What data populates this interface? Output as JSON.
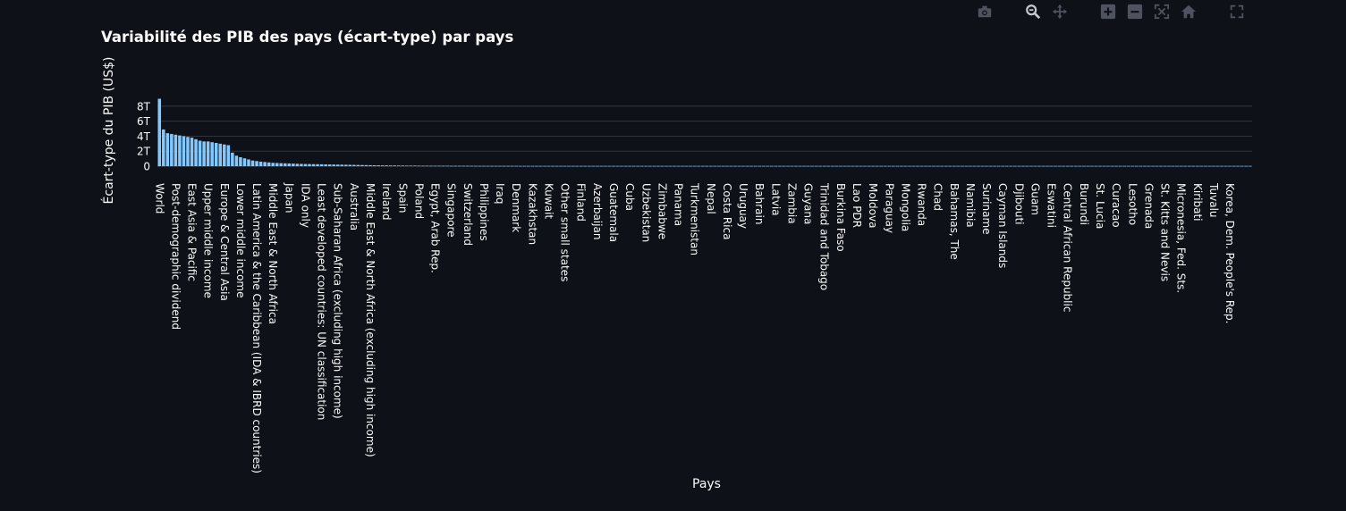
{
  "chart_data": {
    "type": "bar",
    "title": "Variabilité des PIB des pays (écart-type) par pays",
    "xlabel": "Pays",
    "ylabel": "Écart-type du PIB (US$)",
    "ylim": [
      0,
      9.3
    ],
    "yticks": [
      {
        "value": 0,
        "label": "0"
      },
      {
        "value": 2,
        "label": "2T"
      },
      {
        "value": 4,
        "label": "4T"
      },
      {
        "value": 6,
        "label": "6T"
      },
      {
        "value": 8,
        "label": "8T"
      }
    ],
    "bar_color": "#83c9ff",
    "grid": true,
    "categories_labeled": [
      "World",
      "Post-demographic dividend",
      "East Asia & Pacific",
      "Upper middle income",
      "Europe & Central Asia",
      "Lower middle income",
      "Latin America & the Caribbean (IDA & IBRD countries)",
      "Middle East & North Africa",
      "Japan",
      "IDA only",
      "Least developed countries: UN classification",
      "Sub-Saharan Africa (excluding high income)",
      "Australia",
      "Middle East & North Africa (excluding high income)",
      "Ireland",
      "Spain",
      "Poland",
      "Egypt, Arab Rep.",
      "Singapore",
      "Switzerland",
      "Philippines",
      "Iraq",
      "Denmark",
      "Kazakhstan",
      "Kuwait",
      "Other small states",
      "Finland",
      "Azerbaijan",
      "Guatemala",
      "Cuba",
      "Uzbekistan",
      "Zimbabwe",
      "Panama",
      "Turkmenistan",
      "Nepal",
      "Costa Rica",
      "Uruguay",
      "Bahrain",
      "Latvia",
      "Zambia",
      "Guyana",
      "Trinidad and Tobago",
      "Burkina Faso",
      "Lao PDR",
      "Moldova",
      "Paraguay",
      "Mongolia",
      "Rwanda",
      "Chad",
      "Bahamas, The",
      "Namibia",
      "Suriname",
      "Cayman Islands",
      "Djibouti",
      "Guam",
      "Eswatini",
      "Central African Republic",
      "Burundi",
      "St. Lucia",
      "Curacao",
      "Lesotho",
      "Grenada",
      "St. Kitts and Nevis",
      "Micronesia, Fed. Sts.",
      "Kiribati",
      "Tuvalu",
      "Korea, Dem. People's Rep."
    ],
    "values": [
      9.0,
      4.9,
      4.4,
      4.3,
      4.2,
      4.1,
      4.0,
      3.9,
      3.8,
      3.6,
      3.4,
      3.3,
      3.3,
      3.2,
      3.1,
      3.0,
      2.9,
      2.8,
      1.8,
      1.4,
      1.2,
      1.05,
      0.9,
      0.75,
      0.68,
      0.6,
      0.55,
      0.5,
      0.45,
      0.42,
      0.4,
      0.38,
      0.36,
      0.34,
      0.32,
      0.3,
      0.29,
      0.28,
      0.27,
      0.26,
      0.25,
      0.24,
      0.23,
      0.22,
      0.21,
      0.2,
      0.19,
      0.18,
      0.17,
      0.16,
      0.15,
      0.14,
      0.13,
      0.12,
      0.11,
      0.1,
      0.1,
      0.09,
      0.09,
      0.08,
      0.08,
      0.07,
      0.07,
      0.07,
      0.06,
      0.06,
      0.06,
      0.05,
      0.05,
      0.05,
      0.05,
      0.05,
      0.04,
      0.04,
      0.04,
      0.04,
      0.04,
      0.04,
      0.03,
      0.03,
      0.03,
      0.03,
      0.03,
      0.03,
      0.03,
      0.03,
      0.03,
      0.03,
      0.03,
      0.02,
      0.02,
      0.02,
      0.02,
      0.02,
      0.02,
      0.02,
      0.02,
      0.02,
      0.02,
      0.02,
      0.02,
      0.02,
      0.02,
      0.02,
      0.02,
      0.02,
      0.02,
      0.02,
      0.02,
      0.02,
      0.02,
      0.02,
      0.02,
      0.02,
      0.02,
      0.02,
      0.02,
      0.02,
      0.02,
      0.02,
      0.02,
      0.02,
      0.02,
      0.02,
      0.02,
      0.02,
      0.02,
      0.02,
      0.02,
      0.02,
      0.02,
      0.02,
      0.02,
      0.02,
      0.02,
      0.02,
      0.02,
      0.02,
      0.02,
      0.02,
      0.02,
      0.02,
      0.02,
      0.02,
      0.02,
      0.02,
      0.02,
      0.02,
      0.02,
      0.02,
      0.02,
      0.02,
      0.02,
      0.02,
      0.02,
      0.02,
      0.02,
      0.02,
      0.02,
      0.02,
      0.02,
      0.02,
      0.02,
      0.02,
      0.02,
      0.02,
      0.02,
      0.02,
      0.02,
      0.02,
      0.02,
      0.02,
      0.02,
      0.02,
      0.02,
      0.02,
      0.02,
      0.02,
      0.02,
      0.02,
      0.02,
      0.02,
      0.02,
      0.02,
      0.02,
      0.02,
      0.02,
      0.02,
      0.02,
      0.02,
      0.02,
      0.02,
      0.02,
      0.02,
      0.02,
      0.02,
      0.02,
      0.02,
      0.02,
      0.02,
      0.02,
      0.02,
      0.02,
      0.02,
      0.02,
      0.02,
      0.02,
      0.02,
      0.02,
      0.02,
      0.02,
      0.02,
      0.02,
      0.02,
      0.02,
      0.02,
      0.02,
      0.02,
      0.02,
      0.02,
      0.02,
      0.02,
      0.02,
      0.02,
      0.02,
      0.02,
      0.02,
      0.02,
      0.02,
      0.02,
      0.02,
      0.02,
      0.02,
      0.02,
      0.02,
      0.02,
      0.02,
      0.02,
      0.02,
      0.02,
      0.02,
      0.02,
      0.02,
      0.02,
      0.02,
      0.02,
      0.02,
      0.02,
      0.02,
      0.02,
      0.02,
      0.02,
      0.02,
      0.02,
      0.02,
      0.02,
      0.02,
      0.02,
      0.02,
      0.02,
      0.02,
      0.02,
      0.02,
      0.02,
      0.02,
      0.02,
      0.02,
      0.02,
      0.02,
      0.02
    ]
  },
  "modebar": [
    {
      "name": "camera-icon",
      "title": "Download plot as a png"
    },
    {
      "name": "zoom-icon",
      "title": "Zoom"
    },
    {
      "name": "pan-icon",
      "title": "Pan"
    },
    {
      "name": "zoom-in-icon",
      "title": "Zoom in"
    },
    {
      "name": "zoom-out-icon",
      "title": "Zoom out"
    },
    {
      "name": "autoscale-icon",
      "title": "Autoscale"
    },
    {
      "name": "reset-axes-icon",
      "title": "Reset axes"
    },
    {
      "name": "fullscreen-icon",
      "title": "Fullscreen"
    }
  ]
}
